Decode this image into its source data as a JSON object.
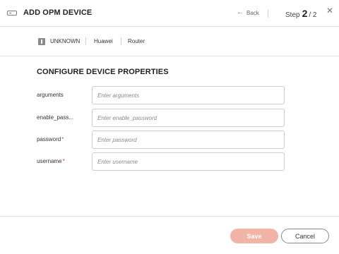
{
  "header": {
    "icon": "device-icon",
    "title": "ADD OPM DEVICE",
    "back_label": "Back",
    "step_label": "Step",
    "step_current": "2",
    "step_total": "/ 2",
    "close_icon": "close-icon"
  },
  "device": {
    "status_icon": "unknown-status-icon",
    "status": "UNKNOWN",
    "vendor": "Huawei",
    "type": "Router"
  },
  "form": {
    "section_title": "CONFIGURE DEVICE PROPERTIES",
    "fields": [
      {
        "label": "arguments",
        "required": false,
        "value": "",
        "placeholder": "Enter arguments"
      },
      {
        "label": "enable_pass...",
        "required": false,
        "value": "",
        "placeholder": "Enter enable_password"
      },
      {
        "label": "password",
        "required": true,
        "value": "",
        "placeholder": "Enter password"
      },
      {
        "label": "username",
        "required": true,
        "value": "",
        "placeholder": "Enter username"
      }
    ],
    "required_marker": "*"
  },
  "footer": {
    "save_label": "Save",
    "cancel_label": "Cancel"
  },
  "colors": {
    "save_button_disabled": "#f1b4a6",
    "required_marker": "#d9434c"
  }
}
